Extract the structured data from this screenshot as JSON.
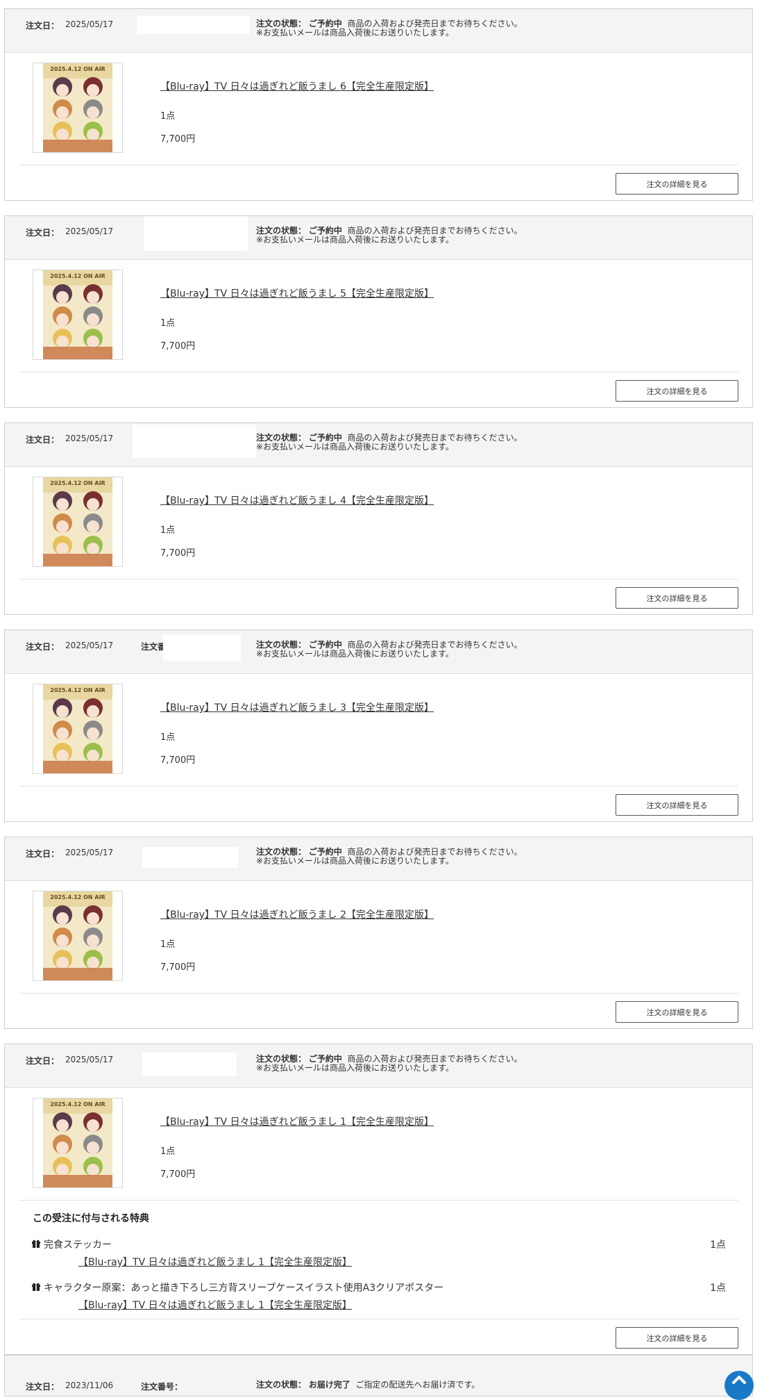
{
  "labels": {
    "order_date": "注文日：",
    "order_status": "注文の状態：",
    "order_number": "注文番号：",
    "detail_button": "注文の詳細を見る",
    "bonus_heading": "この受注に付与される特典"
  },
  "colors": {
    "header_bg": "#f4f4f4",
    "border": "#cfcfcf",
    "text": "#333333",
    "scroll_top_button": "#1a78c9"
  },
  "orders": [
    {
      "date": "2025/05/17",
      "status": "ご予約中",
      "status_note_1": "商品の入荷および発売日までお待ちください。",
      "status_note_2": "※お支払いメールは商品入荷後にお送りいたします。",
      "product_title": "【Blu-ray】TV 日々は過ぎれど飯うまし 6【完全生産限定版】",
      "quantity": "1点",
      "price": "7,700円",
      "image_caption": "2025.4.12 ON AIR"
    },
    {
      "date": "2025/05/17",
      "status": "ご予約中",
      "status_note_1": "商品の入荷および発売日までお待ちください。",
      "status_note_2": "※お支払いメールは商品入荷後にお送りいたします。",
      "product_title": "【Blu-ray】TV 日々は過ぎれど飯うまし 5【完全生産限定版】",
      "quantity": "1点",
      "price": "7,700円",
      "image_caption": "2025.4.12 ON AIR"
    },
    {
      "date": "2025/05/17",
      "status": "ご予約中",
      "status_note_1": "商品の入荷および発売日までお待ちください。",
      "status_note_2": "※お支払いメールは商品入荷後にお送りいたします。",
      "product_title": "【Blu-ray】TV 日々は過ぎれど飯うまし 4【完全生産限定版】",
      "quantity": "1点",
      "price": "7,700円",
      "image_caption": "2025.4.12 ON AIR"
    },
    {
      "date": "2025/05/17",
      "status": "ご予約中",
      "status_note_1": "商品の入荷および発売日までお待ちください。",
      "status_note_2": "※お支払いメールは商品入荷後にお送りいたします。",
      "product_title": "【Blu-ray】TV 日々は過ぎれど飯うまし 3【完全生産限定版】",
      "quantity": "1点",
      "price": "7,700円",
      "image_caption": "2025.4.12 ON AIR"
    },
    {
      "date": "2025/05/17",
      "status": "ご予約中",
      "status_note_1": "商品の入荷および発売日までお待ちください。",
      "status_note_2": "※お支払いメールは商品入荷後にお送りいたします。",
      "product_title": "【Blu-ray】TV 日々は過ぎれど飯うまし 2【完全生産限定版】",
      "quantity": "1点",
      "price": "7,700円",
      "image_caption": "2025.4.12 ON AIR"
    },
    {
      "date": "2025/05/17",
      "status": "ご予約中",
      "status_note_1": "商品の入荷および発売日までお待ちください。",
      "status_note_2": "※お支払いメールは商品入荷後にお送りいたします。",
      "product_title": "【Blu-ray】TV 日々は過ぎれど飯うまし 1【完全生産限定版】",
      "quantity": "1点",
      "price": "7,700円",
      "image_caption": "2025.4.12 ON AIR",
      "bonuses": [
        {
          "icon": "gift-icon",
          "name": "完食ステッカー",
          "quantity": "1点",
          "product_link": "【Blu-ray】TV 日々は過ぎれど飯うまし 1【完全生産限定版】"
        },
        {
          "icon": "gift-icon",
          "name": "キャラクター原案：あっと描き下ろし三方背スリーブケースイラスト使用A3クリアポスター",
          "quantity": "1点",
          "product_link": "【Blu-ray】TV 日々は過ぎれど飯うまし 1【完全生産限定版】"
        }
      ]
    }
  ],
  "partial_order": {
    "date": "2023/11/06",
    "status": "お届け完了",
    "status_note_1": "ご指定の配送先へお届け済です。"
  }
}
